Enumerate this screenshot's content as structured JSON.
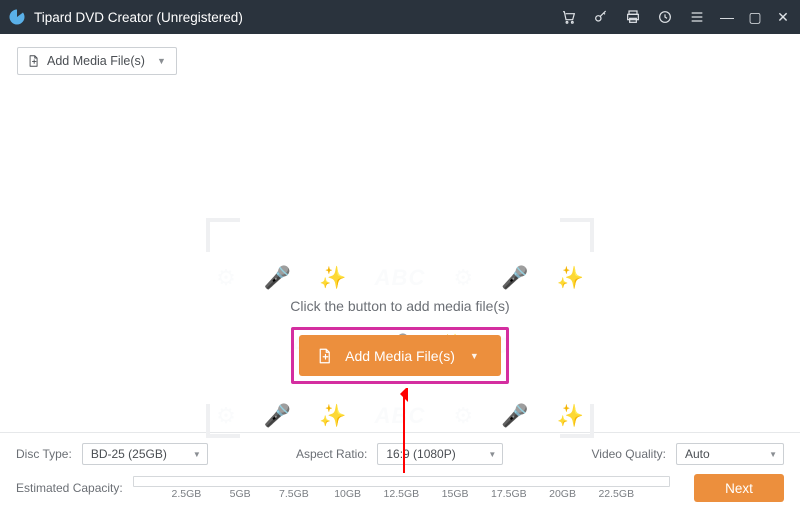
{
  "titlebar": {
    "text": "Tipard DVD Creator (Unregistered)"
  },
  "toolbar": {
    "add_media_label": "Add Media File(s)"
  },
  "drop": {
    "hint": "Click the button to add media file(s)",
    "add_media_label": "Add Media File(s)"
  },
  "bottom": {
    "disc_type_label": "Disc Type:",
    "disc_type_value": "BD-25 (25GB)",
    "aspect_label": "Aspect Ratio:",
    "aspect_value": "16:9 (1080P)",
    "quality_label": "Video Quality:",
    "quality_value": "Auto",
    "capacity_label": "Estimated Capacity:",
    "next_label": "Next",
    "ticks": [
      "2.5GB",
      "5GB",
      "7.5GB",
      "10GB",
      "12.5GB",
      "15GB",
      "17.5GB",
      "20GB",
      "22.5GB"
    ]
  }
}
